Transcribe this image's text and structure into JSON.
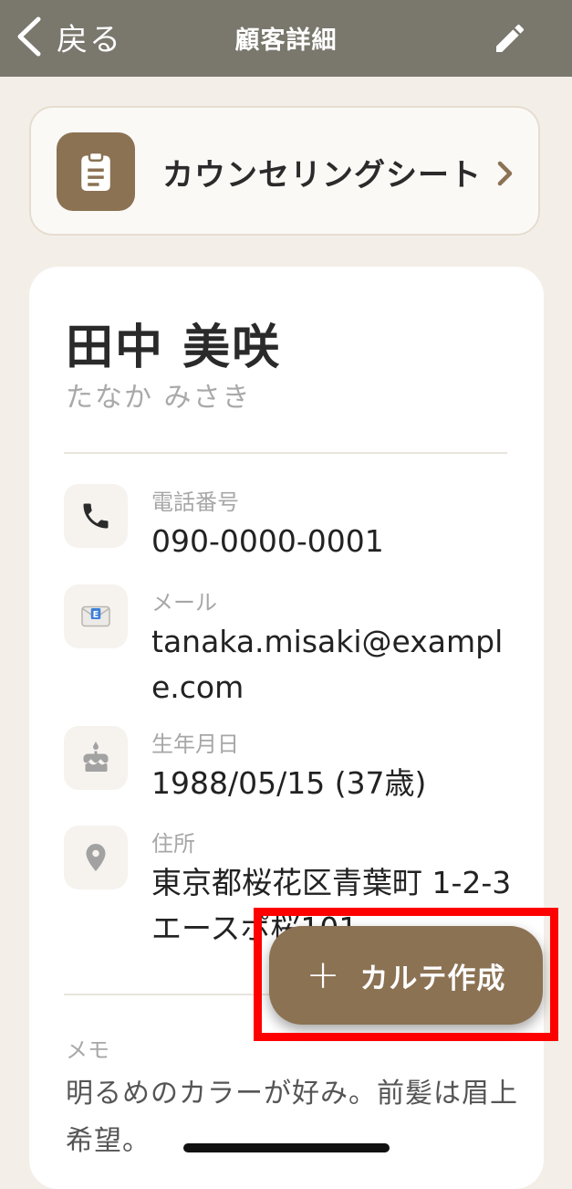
{
  "navbar": {
    "back_label": "戻る",
    "title": "顧客詳細",
    "edit_icon": "pencil-icon",
    "background": "#7a776d"
  },
  "counseling": {
    "label": "カウンセリングシート",
    "icon": "clipboard-icon",
    "accent": "#8b7253"
  },
  "customer": {
    "name": "田中 美咲",
    "kana": "たなか みさき",
    "fields": [
      {
        "icon": "phone-icon",
        "label": "電話番号",
        "value": "090-0000-0001"
      },
      {
        "icon": "email-icon",
        "label": "メール",
        "value": "tanaka.misaki@example.com"
      },
      {
        "icon": "cake-icon",
        "label": "生年月日",
        "value": "1988/05/15 (37歳)"
      },
      {
        "icon": "location-pin-icon",
        "label": "住所",
        "value": "東京都桜花区青葉町 1-2-3 エースポ桜101"
      }
    ],
    "memo_label": "メモ",
    "memo": "明るめのカラーが好み。前髪は眉上希望。"
  },
  "fab": {
    "icon": "plus-icon",
    "label": "カルテ作成",
    "highlight_color": "#ff0000"
  }
}
